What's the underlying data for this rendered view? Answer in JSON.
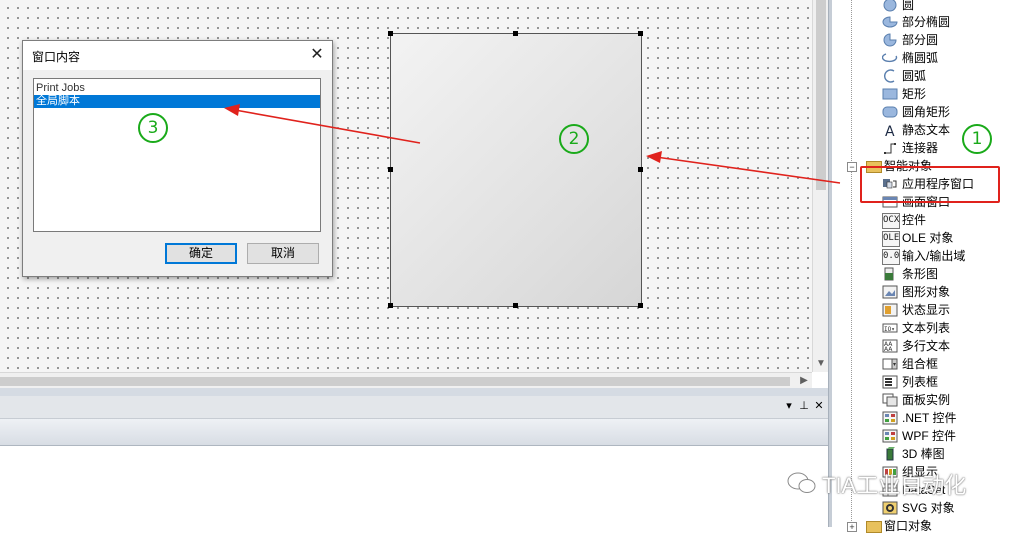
{
  "dialog": {
    "title": "窗口内容",
    "close": "✕",
    "items": [
      "Print Jobs",
      "全局脚本"
    ],
    "ok": "确定",
    "cancel": "取消"
  },
  "toolbox": {
    "items": [
      {
        "label": "圆",
        "icon": "circle-icon"
      },
      {
        "label": "部分椭圆",
        "icon": "partial-ellipse-icon"
      },
      {
        "label": "部分圆",
        "icon": "partial-circle-icon"
      },
      {
        "label": "椭圆弧",
        "icon": "ellipse-arc-icon"
      },
      {
        "label": "圆弧",
        "icon": "arc-icon"
      },
      {
        "label": "矩形",
        "icon": "rectangle-icon"
      },
      {
        "label": "圆角矩形",
        "icon": "rounded-rectangle-icon"
      },
      {
        "label": "静态文本",
        "icon": "static-text-icon"
      },
      {
        "label": "连接器",
        "icon": "connector-icon"
      }
    ],
    "smart_group": "智能对象",
    "smart_items": [
      {
        "label": "应用程序窗口",
        "icon": "application-window-icon"
      },
      {
        "label": "画面窗口",
        "icon": "picture-window-icon"
      },
      {
        "label": "控件",
        "icon": "ocx-icon",
        "sym": "OCX"
      },
      {
        "label": "OLE 对象",
        "icon": "ole-icon",
        "sym": "OLE"
      },
      {
        "label": "输入/输出域",
        "icon": "io-field-icon",
        "sym": "0.0"
      },
      {
        "label": "条形图",
        "icon": "bar-icon"
      },
      {
        "label": "图形对象",
        "icon": "graphic-object-icon"
      },
      {
        "label": "状态显示",
        "icon": "status-display-icon"
      },
      {
        "label": "文本列表",
        "icon": "text-list-icon"
      },
      {
        "label": "多行文本",
        "icon": "multiline-text-icon"
      },
      {
        "label": "组合框",
        "icon": "combobox-icon"
      },
      {
        "label": "列表框",
        "icon": "listbox-icon"
      },
      {
        "label": "面板实例",
        "icon": "faceplate-icon"
      },
      {
        "label": ".NET 控件",
        "icon": "dotnet-icon"
      },
      {
        "label": "WPF 控件",
        "icon": "wpf-icon"
      },
      {
        "label": "3D 棒图",
        "icon": "bar3d-icon"
      },
      {
        "label": "组显示",
        "icon": "group-display-icon"
      },
      {
        "label": "DataSet",
        "icon": "dataset-icon"
      },
      {
        "label": "SVG 对象",
        "icon": "svg-icon"
      }
    ],
    "window_group": "窗口对象"
  },
  "annotations": {
    "one": "1",
    "two": "2",
    "three": "3"
  },
  "watermark": "TIA工业自动化",
  "colors": {
    "selection": "#0078d7",
    "annotation_red": "#e0221c",
    "annotation_green": "#1aaa1a"
  }
}
